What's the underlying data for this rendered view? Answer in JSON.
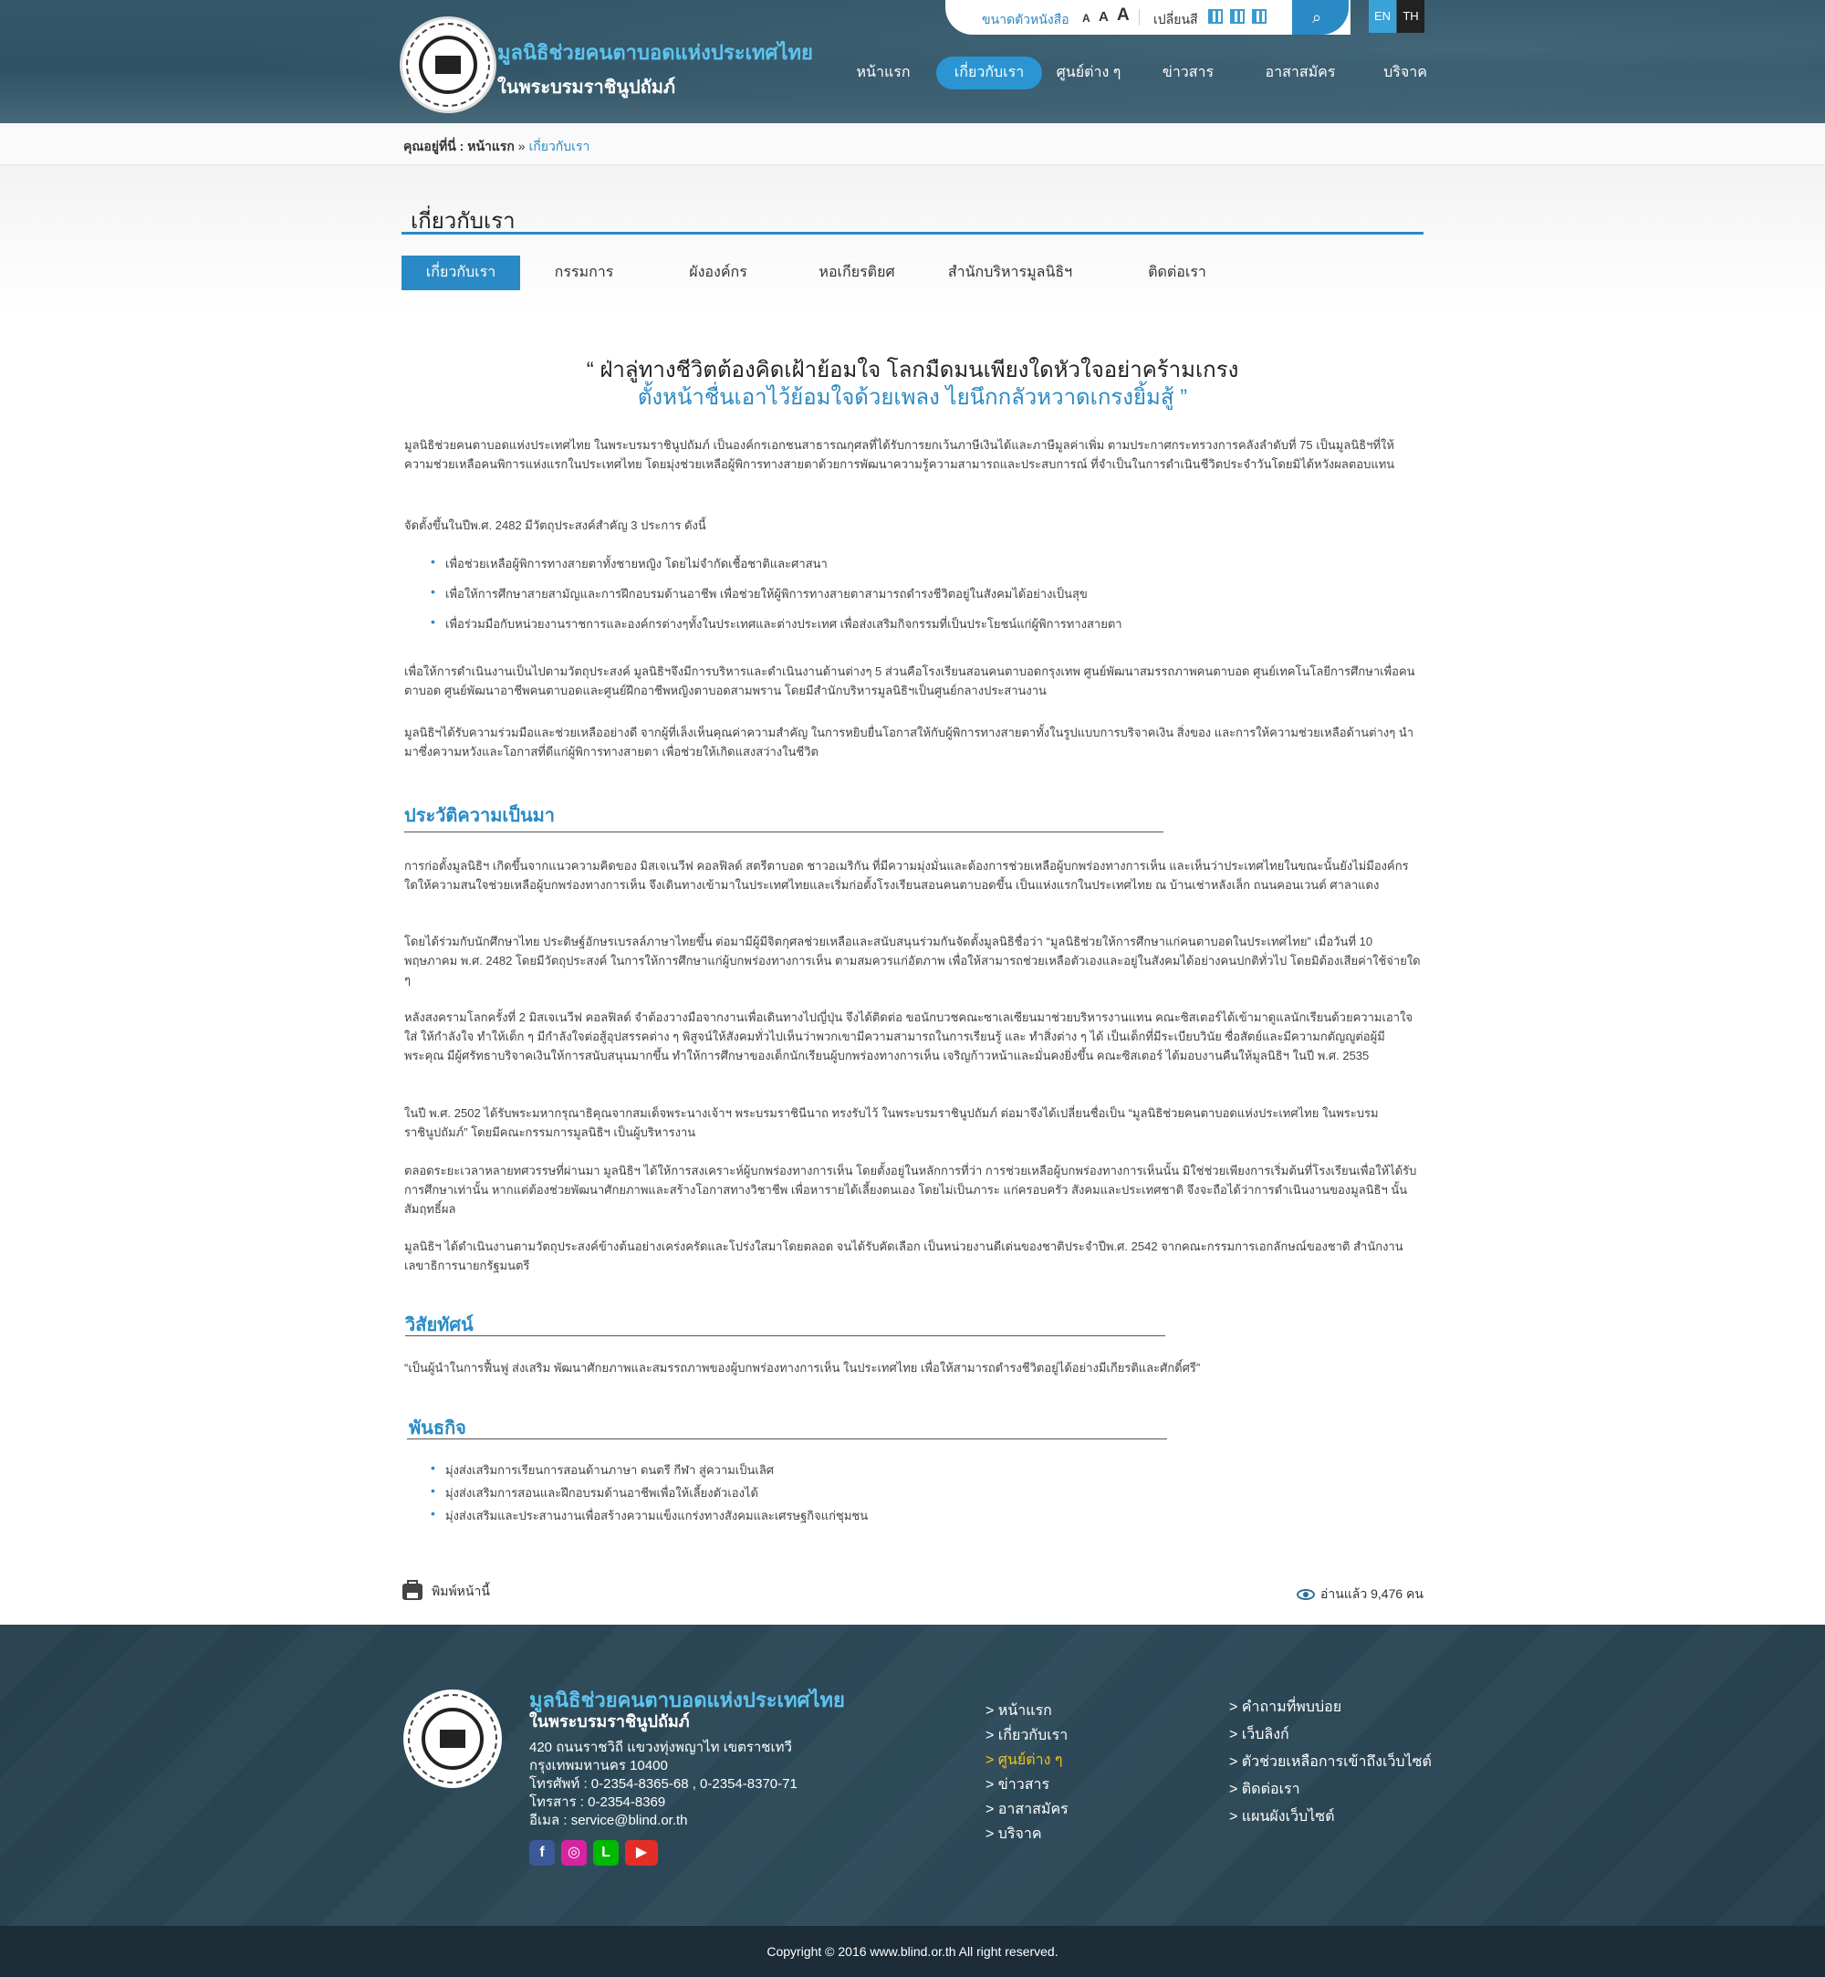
{
  "header": {
    "site_name_line1": "มูลนิธิช่วยคนตาบอดแห่งประเทศไทย",
    "site_name_line2": "ในพระบรมราชินูปถัมภ์",
    "font_size_label": "ขนาดตัวหนังสือ",
    "font_sizes": [
      "A",
      "A",
      "A"
    ],
    "color_label": "เปลี่ยนสี",
    "search_icon": "search-icon",
    "lang_en": "EN",
    "lang_th": "TH",
    "nav": [
      "หน้าแรก",
      "เกี่ยวกับเรา",
      "ศูนย์ต่าง ๆ",
      "ข่าวสาร",
      "อาสาสมัคร",
      "บริจาค"
    ],
    "accent_color": "#2a8ac6"
  },
  "breadcrumb": {
    "prefix": "คุณอยู่ที่นี่ :",
    "home": "หน้าแรก",
    "sep": "»",
    "current": "เกี่ยวกับเรา"
  },
  "page": {
    "title": "เกี่ยวกับเรา",
    "subtabs": [
      "เกี่ยวกับเรา",
      "กรรมการ",
      "ผังองค์กร",
      "หอเกียรติยศ",
      "สำนักบริหารมูลนิธิฯ",
      "ติดต่อเรา"
    ]
  },
  "content": {
    "quote_line1": "“ ฝ่าลู่ทางชีวิตต้องคิดเฝ้าย้อมใจ โลกมืดมนเพียงใดหัวใจอย่าคร้ามเกรง",
    "quote_line2": "ตั้งหน้าชื่นเอาไว้ย้อมใจด้วยเพลง ไยนึกกลัวหวาดเกรงยิ้มสู้ ”",
    "intro": "มูลนิธิช่วยคนตาบอดแห่งประเทศไทย ในพระบรมราชินูปถัมภ์ เป็นองค์กรเอกชนสาธารณกุศลที่ได้รับการยกเว้นภาษีเงินได้และภาษีมูลค่าเพิ่ม ตามประกาศกระทรวงการคลังลำดับที่ 75 เป็นมูลนิธิฯที่ให้ความช่วยเหลือคนพิการแห่งแรกในประเทศไทย โดยมุ่งช่วยเหลือผู้พิการทางสายตาด้วยการพัฒนาความรู้ความสามารถและประสบการณ์ ที่จำเป็นในการดำเนินชีวิตประจำวันโดยมิได้หวังผลตอบแทน",
    "objectives_intro": "จัดตั้งขึ้นในปีพ.ศ. 2482 มีวัตถุประสงค์สำคัญ 3 ประการ ดังนี้",
    "objectives": [
      "เพื่อช่วยเหลือผู้พิการทางสายตาทั้งชายหญิง โดยไม่จำกัดเชื้อชาติและศาสนา",
      "เพื่อให้การศึกษาสายสามัญและการฝึกอบรมด้านอาชีพ เพื่อช่วยให้ผู้พิการทางสายตาสามารถดำรงชีวิตอยู่ในสังคมได้อย่างเป็นสุข",
      "เพื่อร่วมมือกับหน่วยงานราชการและองค์กรต่างๆทั้งในประเทศและต่างประเทศ เพื่อส่งเสริมกิจกรรมที่เป็นประโยชน์แก่ผู้พิการทางสายตา"
    ],
    "para_admin": "เพื่อให้การดำเนินงานเป็นไปตามวัตถุประสงค์ มูลนิธิฯจึงมีการบริหารและดำเนินงานด้านต่างๆ 5 ส่วนคือโรงเรียนสอนคนตาบอดกรุงเทพ ศูนย์พัฒนาสมรรถภาพคนตาบอด ศูนย์เทคโนโลยีการศึกษาเพื่อคนตาบอด ศูนย์พัฒนาอาชีพคนตาบอดและศูนย์ฝึกอาชีพหญิงตาบอดสามพราน โดยมีสำนักบริหารมูลนิธิฯเป็นศูนย์กลางประสานงาน",
    "para_support": "มูลนิธิฯได้รับความร่วมมือและช่วยเหลืออย่างดี จากผู้ที่เล็งเห็นคุณค่าความสำคัญ ในการหยิบยื่นโอกาสให้กับผู้พิการทางสายตาทั้งในรูปแบบการบริจาคเงิน สิ่งของ และการให้ความช่วยเหลือด้านต่างๆ นำมาซึ่งความหวังและโอกาสที่ดีแก่ผู้พิการทางสายตา เพื่อช่วยให้เกิดแสงสว่างในชีวิต",
    "history_title": "ประวัติความเป็นมา",
    "history": [
      "การก่อตั้งมูลนิธิฯ เกิดขึ้นจากแนวความคิดของ มิสเจเนวีฟ คอลฟิลด์ สตรีตาบอด ชาวอเมริกัน ที่มีความมุ่งมั่นและต้องการช่วยเหลือผู้บกพร่องทางการเห็น และเห็นว่าประเทศไทยในขณะนั้นยังไม่มีองค์กรใดให้ความสนใจช่วยเหลือผู้บกพร่องทางการเห็น จึงเดินทางเข้ามาในประเทศไทยและเริ่มก่อตั้งโรงเรียนสอนคนตาบอดขึ้น เป็นแห่งแรกในประเทศไทย ณ บ้านเช่าหลังเล็ก ถนนคอนเวนต์ ศาลาแดง",
      "โดยได้ร่วมกับนักศึกษาไทย ประดิษฐ์อักษรเบรลล์ภาษาไทยขึ้น ต่อมามีผู้มีจิตกุศลช่วยเหลือและสนับสนุนร่วมกันจัดตั้งมูลนิธิชื่อว่า “มูลนิธิช่วยให้การศึกษาแก่คนตาบอดในประเทศไทย” เมื่อวันที่ 10 พฤษภาคม พ.ศ. 2482 โดยมีวัตถุประสงค์ ในการให้การศึกษาแก่ผู้บกพร่องทางการเห็น ตามสมควรแก่อัตภาพ เพื่อให้สามารถช่วยเหลือตัวเองและอยู่ในสังคมได้อย่างคนปกติทั่วไป โดยมิต้องเสียค่าใช้จ่ายใด ๆ",
      "หลังสงครามโลกครั้งที่ 2 มิสเจเนวีฟ คอลฟิลด์ จำต้องวางมือจากงานเพื่อเดินทางไปญี่ปุ่น จึงได้ติดต่อ ขอนักบวชคณะซาเลเซียนมาช่วยบริหารงานแทน คณะซิสเตอร์ได้เข้ามาดูแลนักเรียนด้วยความเอาใจใส่ ให้กำลังใจ ทำให้เด็ก ๆ มีกำลังใจต่อสู้อุปสรรคต่าง ๆ พิสูจน์ให้สังคมทั่วไปเห็นว่าพวกเขามีความสามารถในการเรียนรู้ และ ทำสิ่งต่าง ๆ ได้ เป็นเด็กที่มีระเบียบวินัย ซื่อสัตย์และมีความกตัญญูต่อผู้มีพระคุณ มีผู้ศรัทธาบริจาคเงินให้การสนับสนุนมากขึ้น ทำให้การศึกษาของเด็กนักเรียนผู้บกพร่องทางการเห็น เจริญก้าวหน้าและมั่นคงยิ่งขึ้น คณะซิสเตอร์ ได้มอบงานคืนให้มูลนิธิฯ ในปี พ.ศ. 2535",
      "ในปี พ.ศ. 2502 ได้รับพระมหากรุณาธิคุณจากสมเด็จพระนางเจ้าฯ พระบรมราชินีนาถ ทรงรับไว้ ในพระบรมราชินูปถัมภ์ ต่อมาจึงได้เปลี่ยนชื่อเป็น “มูลนิธิช่วยคนตาบอดแห่งประเทศไทย ในพระบรมราชินูปถัมภ์” โดยมีคณะกรรมการมูลนิธิฯ เป็นผู้บริหารงาน",
      "ตลอดระยะเวลาหลายทศวรรษที่ผ่านมา มูลนิธิฯ ได้ให้การสงเคราะห์ผู้บกพร่องทางการเห็น โดยตั้งอยู่ในหลักการที่ว่า การช่วยเหลือผู้บกพร่องทางการเห็นนั้น มิใช่ช่วยเพียงการเริ่มต้นที่โรงเรียนเพื่อให้ได้รับการศึกษาเท่านั้น หากแต่ต้องช่วยพัฒนาศักยภาพและสร้างโอกาสทางวิชาชีพ เพื่อหารายได้เลี้ยงตนเอง โดยไม่เป็นภาระ แก่ครอบครัว สังคมและประเทศชาติ จึงจะถือได้ว่าการดำเนินงานของมูลนิธิฯ นั้น สัมฤทธิ์ผล",
      "มูลนิธิฯ ได้ดำเนินงานตามวัตถุประสงค์ข้างต้นอย่างเคร่งครัดและโปร่งใสมาโดยตลอด  จนได้รับคัดเลือก เป็นหน่วยงานดีเด่นของชาติประจำปีพ.ศ. 2542 จากคณะกรรมการเอกลักษณ์ของชาติ สำนักงานเลขาธิการนายกรัฐมนตรี"
    ],
    "vision_title": "วิสัยทัศน์",
    "vision": "“เป็นผู้นำในการฟื้นฟู ส่งเสริม พัฒนาศักยภาพและสมรรถภาพของผู้บกพร่องทางการเห็น ในประเทศไทย เพื่อให้สามารถดำรงชีวิตอยู่ได้อย่างมีเกียรติและศักดิ์ศรี”",
    "mission_title": "พันธกิจ",
    "mission": [
      "มุ่งส่งเสริมการเรียนการสอนด้านภาษา ดนตรี กีฬา สู่ความเป็นเลิศ",
      "มุ่งส่งเสริมการสอนและฝึกอบรมด้านอาชีพเพื่อให้เลี้ยงตัวเองได้",
      "มุ่งส่งเสริมและประสานงานเพื่อสร้างความแข็งแกร่งทางสังคมและเศรษฐกิจแก่ชุมชน"
    ],
    "print_label": "พิมพ์หน้านี้",
    "views_label": "อ่านแล้ว 9,476 คน"
  },
  "footer": {
    "name1": "มูลนิธิช่วยคนตาบอดแห่งประเทศไทย",
    "name2": "ในพระบรมราชินูปถัมภ์",
    "address": [
      "420 ถนนราชวิถี แขวงทุ่งพญาไท เขตราชเทวี",
      "กรุงเทพมหานคร 10400",
      "โทรศัพท์ : 0-2354-8365-68 , 0-2354-8370-71",
      "โทรสาร : 0-2354-8369",
      "อีเมล : service@blind.or.th"
    ],
    "social": [
      {
        "icon": "facebook-icon",
        "glyph": "f",
        "color": "#3b5998"
      },
      {
        "icon": "instagram-icon",
        "glyph": "◎",
        "color": "#d6249f"
      },
      {
        "icon": "line-icon",
        "glyph": "L",
        "color": "#00b900"
      },
      {
        "icon": "youtube-icon",
        "glyph": "▶",
        "color": "#e52d27"
      }
    ],
    "links_col1": [
      "> หน้าแรก",
      "> เกี่ยวกับเรา",
      "> ศูนย์ต่าง ๆ",
      "> ข่าวสาร",
      "> อาสาสมัคร",
      "> บริจาค"
    ],
    "links_col2": [
      "> คำถามที่พบบ่อย",
      "> เว็บลิงก์",
      "> ตัวช่วยเหลือการเข้าถึงเว็บไซต์",
      "> ติดต่อเรา",
      "> แผนผังเว็บไซต์"
    ],
    "copyright": "Copyright © 2016 www.blind.or.th All right reserved."
  }
}
